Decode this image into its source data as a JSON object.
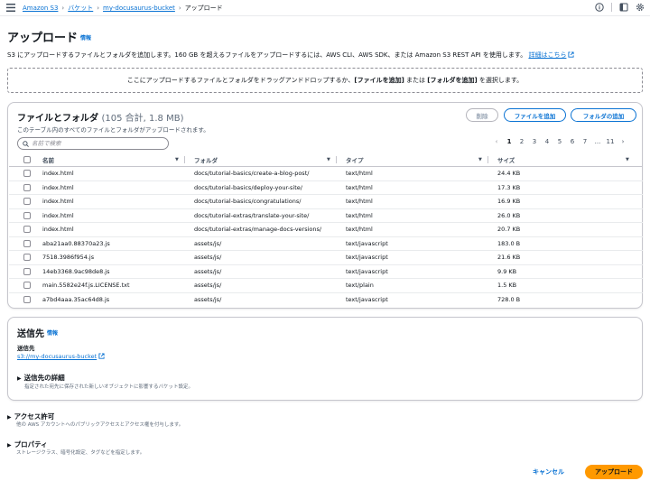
{
  "breadcrumb": {
    "items": [
      "Amazon S3",
      "バケット",
      "my-docusaurus-bucket"
    ],
    "current": "アップロード"
  },
  "header": {
    "title": "アップロード",
    "info": "情報",
    "description": "S3 にアップロードするファイルとフォルダを追加します。160 GB を超えるファイルをアップロードするには、AWS CLI、AWS SDK、または Amazon S3 REST API を使用します。",
    "learn_more": "詳細はこちら"
  },
  "dropzone": {
    "prefix": "ここにアップロードするファイルとフォルダをドラッグアンドドロップするか、",
    "add_files": "[ファイルを追加]",
    "middle": " または ",
    "add_folder": "[フォルダを追加]",
    "suffix": " を選択します。"
  },
  "files": {
    "title": "ファイルとフォルダ",
    "count": "(105 合計, 1.8 MB)",
    "subtitle": "このテーブル内のすべてのファイルとフォルダがアップロードされます。",
    "remove_button": "削除",
    "add_files_button": "ファイルを追加",
    "add_folder_button": "フォルダの追加",
    "search_placeholder": "名前で検索",
    "pagination": [
      "1",
      "2",
      "3",
      "4",
      "5",
      "6",
      "7",
      "...",
      "11"
    ],
    "columns": [
      "名前",
      "フォルダ",
      "タイプ",
      "サイズ"
    ],
    "rows": [
      {
        "name": "index.html",
        "folder": "docs/tutorial-basics/create-a-blog-post/",
        "type": "text/html",
        "size": "24.4 KB"
      },
      {
        "name": "index.html",
        "folder": "docs/tutorial-basics/deploy-your-site/",
        "type": "text/html",
        "size": "17.3 KB"
      },
      {
        "name": "index.html",
        "folder": "docs/tutorial-basics/congratulations/",
        "type": "text/html",
        "size": "16.9 KB"
      },
      {
        "name": "index.html",
        "folder": "docs/tutorial-extras/translate-your-site/",
        "type": "text/html",
        "size": "26.0 KB"
      },
      {
        "name": "index.html",
        "folder": "docs/tutorial-extras/manage-docs-versions/",
        "type": "text/html",
        "size": "20.7 KB"
      },
      {
        "name": "aba21aa0.88370a23.js",
        "folder": "assets/js/",
        "type": "text/javascript",
        "size": "183.0 B"
      },
      {
        "name": "7518.3986f954.js",
        "folder": "assets/js/",
        "type": "text/javascript",
        "size": "21.6 KB"
      },
      {
        "name": "14eb3368.9ac98de8.js",
        "folder": "assets/js/",
        "type": "text/javascript",
        "size": "9.9 KB"
      },
      {
        "name": "main.5582e24f.js.LICENSE.txt",
        "folder": "assets/js/",
        "type": "text/plain",
        "size": "1.5 KB"
      },
      {
        "name": "a7bd4aaa.35ac64d8.js",
        "folder": "assets/js/",
        "type": "text/javascript",
        "size": "728.0 B"
      }
    ]
  },
  "destination": {
    "title": "送信先",
    "info": "情報",
    "label": "送信先",
    "link": "s3://my-docusaurus-bucket",
    "details_title": "送信先の詳細",
    "details_desc": "指定された宛先に保存された新しいオブジェクトに影響するバケット設定。"
  },
  "permissions": {
    "title": "アクセス許可",
    "desc": "他の AWS アカウントへのパブリックアクセスとアクセス権を付与します。"
  },
  "properties": {
    "title": "プロパティ",
    "desc": "ストレージクラス、暗号化設定、タグなどを指定します。"
  },
  "footer": {
    "cancel": "キャンセル",
    "upload": "アップロード"
  },
  "colors": {
    "link": "#0972d3",
    "primary_button": "#ff9900",
    "border": "#c6c6cd"
  }
}
